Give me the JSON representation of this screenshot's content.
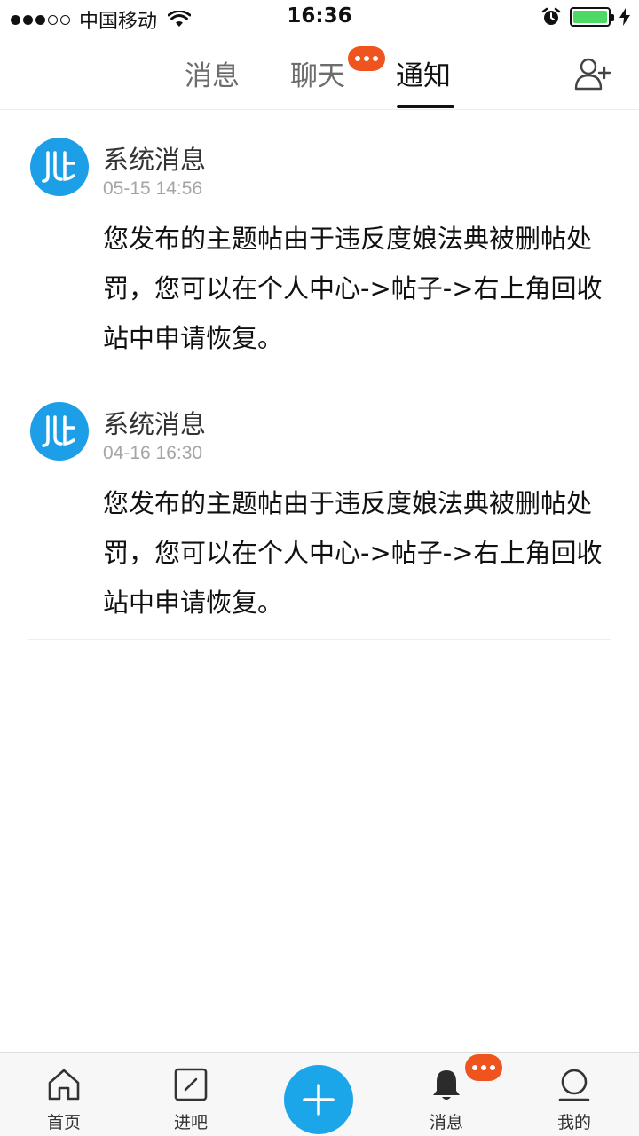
{
  "status_bar": {
    "carrier": "中国移动",
    "time": "16:36"
  },
  "tabs": [
    {
      "label": "消息",
      "active": false
    },
    {
      "label": "聊天",
      "active": false,
      "badge": "•••"
    },
    {
      "label": "通知",
      "active": true
    }
  ],
  "notifications": [
    {
      "title": "系统消息",
      "time": "05-15 14:56",
      "body": "您发布的主题帖由于违反度娘法典被删帖处罚，您可以在个人中心->帖子->右上角回收站中申请恢复。"
    },
    {
      "title": "系统消息",
      "time": "04-16 16:30",
      "body": "您发布的主题帖由于违反度娘法典被删帖处罚，您可以在个人中心->帖子->右上角回收站中申请恢复。"
    }
  ],
  "bottom_nav": {
    "home": "首页",
    "enter_bar": "进吧",
    "messages": "消息",
    "mine": "我的"
  },
  "colors": {
    "accent_blue": "#1ca6ea",
    "badge_orange": "#f0541e",
    "battery_green": "#4cd964"
  },
  "icons": {
    "wifi": "wifi-icon",
    "alarm": "alarm-icon",
    "charging": "charging-bolt-icon",
    "add_friend": "add-friend-icon",
    "avatar_logo": "tieba-logo-icon",
    "home": "home-icon",
    "enter_bar": "enter-bar-icon",
    "post": "plus-icon",
    "bell": "bell-icon",
    "profile": "profile-icon"
  }
}
